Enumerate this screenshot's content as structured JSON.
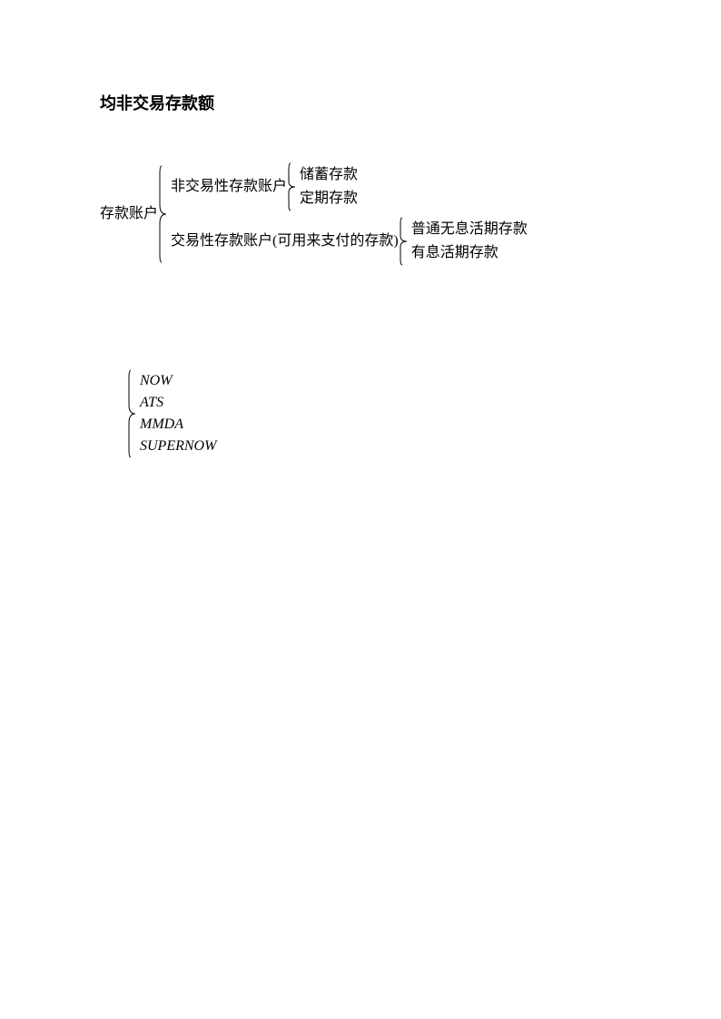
{
  "title": "均非交易存款额",
  "tree": {
    "root": "存款账户",
    "branch1": {
      "label": "非交易性存款账户",
      "leaf1": "储蓄存款",
      "leaf2": "定期存款"
    },
    "branch2": {
      "label": "交易性存款账户(可用来支付的存款)",
      "leaf1": "普通无息活期存款",
      "leaf2": "有息活期存款"
    }
  },
  "list2": {
    "item1": "NOW",
    "item2": "ATS",
    "item3": "MMDA",
    "item4": "SUPERNOW"
  }
}
